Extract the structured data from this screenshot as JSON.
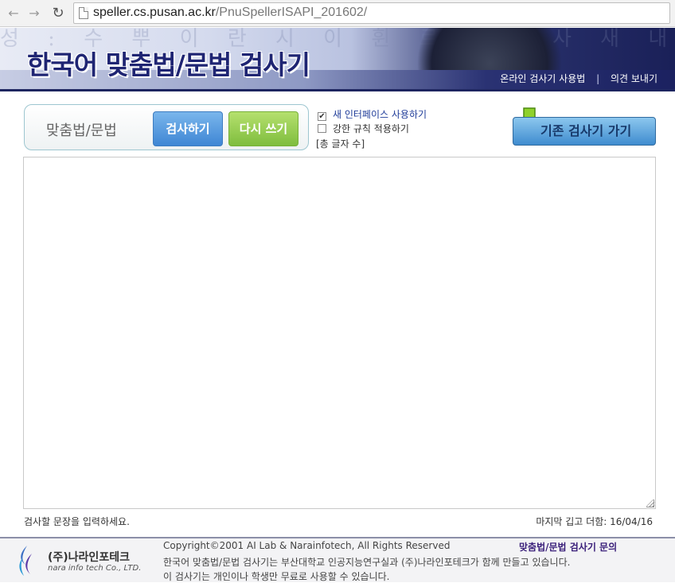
{
  "browser": {
    "url_host": "speller.cs.pusan.ac.kr",
    "url_path": "/PnuSpellerISAPI_201602/"
  },
  "banner": {
    "title": "한국어 맞춤법/문법 검사기",
    "bg_text": "성 : 수 뿌 이 란 시 이 휜 르 便 : 사 새 내 플 무 니 이 文 나",
    "link_manual": "온라인 검사기 사용법",
    "separator": "|",
    "link_feedback": "의견 보내기"
  },
  "toolbar": {
    "label": "맞춤법/문법",
    "check_button": "검사하기",
    "rewrite_button": "다시 쓰기",
    "option_new_ui": "새 인터페이스 사용하기",
    "option_new_ui_checked": true,
    "option_strict": "강한 규칙 적용하기",
    "option_strict_checked": false,
    "char_count": "[총 글자 수]",
    "old_checker_button": "기존 검사기 가기"
  },
  "editor": {
    "hint": "검사할 문장을 입력하세요.",
    "last_update": "마지막 깁고 더함: 16/04/16"
  },
  "footer": {
    "logo_ko": "(주)나라인포테크",
    "logo_en": "nara info tech Co., LTD.",
    "copyright": "Copyright©2001 AI Lab & Narainfotech, All Rights Reserved",
    "line2": "한국어 맞춤법/문법 검사기는 부산대학교 인공지능연구실과 (주)나라인포테크가 함께 만들고 있습니다.",
    "line3": "이 검사기는 개인이나 학생만 무료로 사용할 수 있습니다.",
    "inquiry": "맞춤법/문법 검사기 문의"
  },
  "colors": {
    "title": "#1f2573",
    "check_button": "#3f86d4",
    "rewrite_button": "#7fbd3e",
    "old_button": "#3f8ccf"
  },
  "icons": [
    "back-arrow-icon",
    "forward-arrow-icon",
    "reload-icon",
    "page-icon",
    "down-arrow-icon",
    "checkbox-icon",
    "nara-logo-icon"
  ]
}
